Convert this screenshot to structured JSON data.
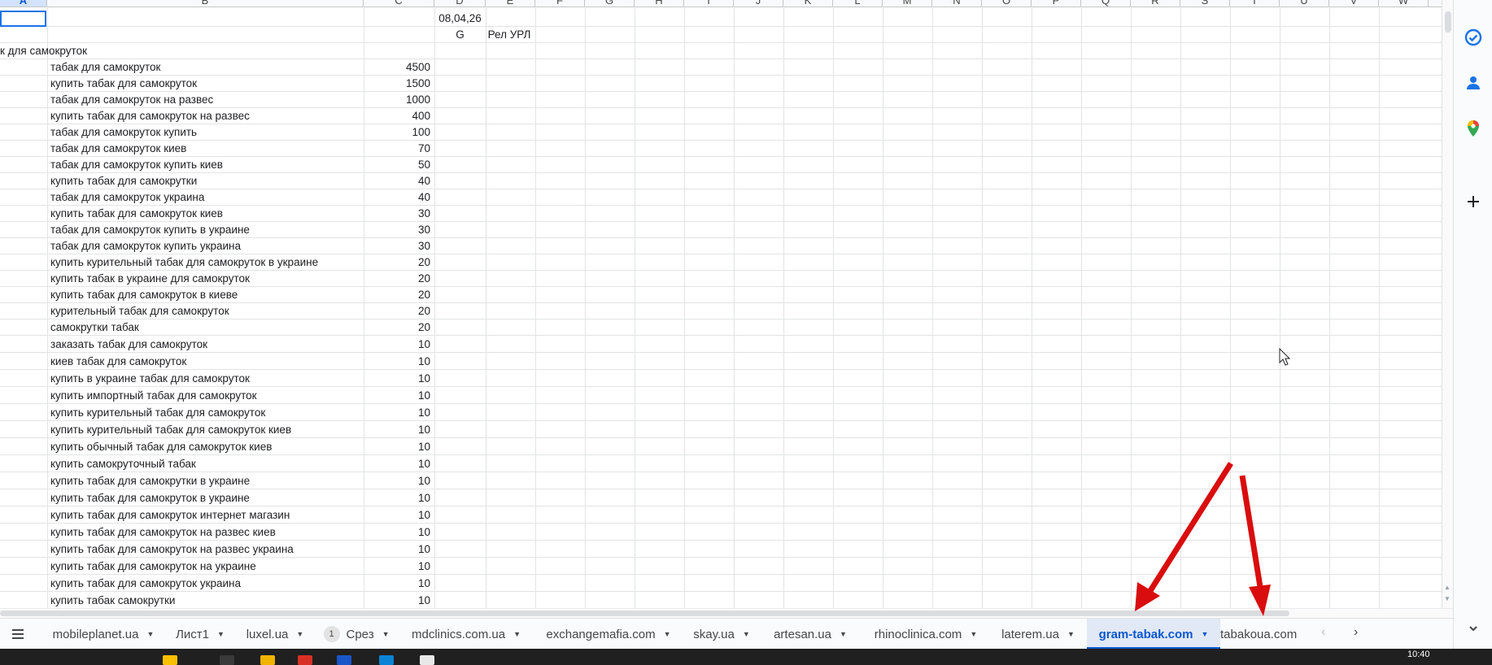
{
  "columns": [
    "A",
    "B",
    "C",
    "D",
    "E",
    "F",
    "G",
    "H",
    "I",
    "J",
    "K",
    "L",
    "M",
    "N",
    "O",
    "P",
    "Q",
    "R",
    "S",
    "T",
    "U",
    "V",
    "W"
  ],
  "header_rows": {
    "date": "08,04,26",
    "col_d_label": "G",
    "col_e_label": "Рел УРЛ",
    "group_title": "к для самокруток"
  },
  "keywords": [
    {
      "keyword": "табак для самокруток",
      "volume": "4500"
    },
    {
      "keyword": "купить табак для самокруток",
      "volume": "1500"
    },
    {
      "keyword": "табак для самокруток на развес",
      "volume": "1000"
    },
    {
      "keyword": "купить табак для самокруток на развес",
      "volume": "400"
    },
    {
      "keyword": "табак для самокруток купить",
      "volume": "100"
    },
    {
      "keyword": "табак для самокруток киев",
      "volume": "70"
    },
    {
      "keyword": "табак для самокруток купить киев",
      "volume": "50"
    },
    {
      "keyword": "купить табак для самокрутки",
      "volume": "40"
    },
    {
      "keyword": "табак для самокруток украина",
      "volume": "40"
    },
    {
      "keyword": "купить табак для самокруток киев",
      "volume": "30"
    },
    {
      "keyword": "табак для самокруток купить в украине",
      "volume": "30"
    },
    {
      "keyword": "табак для самокруток купить украина",
      "volume": "30"
    },
    {
      "keyword": "купить курительный табак для самокруток в украине",
      "volume": "20"
    },
    {
      "keyword": "купить табак в украине для самокруток",
      "volume": "20"
    },
    {
      "keyword": "купить табак для самокруток в киеве",
      "volume": "20"
    },
    {
      "keyword": "курительный табак для самокруток",
      "volume": "20"
    },
    {
      "keyword": "самокрутки табак",
      "volume": "20"
    },
    {
      "keyword": "заказать табак для самокруток",
      "volume": "10"
    },
    {
      "keyword": "киев табак для самокруток",
      "volume": "10"
    },
    {
      "keyword": "купить в украине табак для самокруток",
      "volume": "10"
    },
    {
      "keyword": "купить импортный табак для самокруток",
      "volume": "10"
    },
    {
      "keyword": "купить курительный табак для самокруток",
      "volume": "10"
    },
    {
      "keyword": "купить курительный табак для самокруток киев",
      "volume": "10"
    },
    {
      "keyword": "купить обычный табак для самокруток киев",
      "volume": "10"
    },
    {
      "keyword": "купить самокруточный табак",
      "volume": "10"
    },
    {
      "keyword": "купить табак для самокрутки в украине",
      "volume": "10"
    },
    {
      "keyword": "купить табак для самокруток в украине",
      "volume": "10"
    },
    {
      "keyword": "купить табак для самокруток интернет магазин",
      "volume": "10"
    },
    {
      "keyword": "купить табак для самокруток на развес киев",
      "volume": "10"
    },
    {
      "keyword": "купить табак для самокруток на развес украина",
      "volume": "10"
    },
    {
      "keyword": "купить табак для самокруток на украине",
      "volume": "10"
    },
    {
      "keyword": "купить табак для самокруток украина",
      "volume": "10"
    },
    {
      "keyword": "купить табак самокрутки",
      "volume": "10"
    }
  ],
  "sheet_tabs": [
    {
      "label": "mobileplanet.ua"
    },
    {
      "label": "Лист1"
    },
    {
      "label": "luxel.ua"
    },
    {
      "label": "Срез",
      "badge": "1"
    },
    {
      "label": "mdclinics.com.ua"
    },
    {
      "label": "exchangemafia.com"
    },
    {
      "label": "skay.ua"
    },
    {
      "label": "artesan.ua"
    },
    {
      "label": "rhinoclinica.com"
    },
    {
      "label": "laterem.ua"
    },
    {
      "label": "gram-tabak.com",
      "active": true
    },
    {
      "label": "tabakoua.com"
    }
  ],
  "active_sheet": "gram-tabak.com",
  "taskbar": {
    "clock": "10:40"
  },
  "colors": {
    "accent": "#0b57d0",
    "arrow": "#d90d0d",
    "selection": "#1a73e8"
  },
  "icons": [
    "all-sheets-menu-icon",
    "tasks-icon",
    "contacts-icon",
    "maps-icon",
    "add-icon",
    "scroll-left-icon",
    "scroll-right-icon"
  ]
}
